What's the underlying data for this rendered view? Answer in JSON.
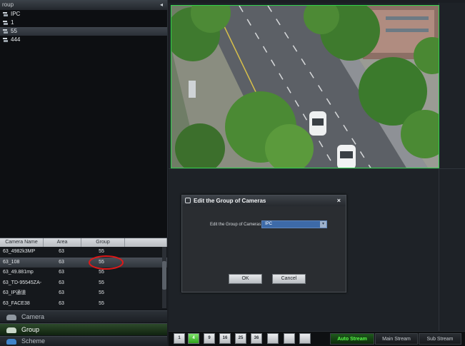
{
  "group_panel": {
    "header": "roup",
    "collapse_glyph": "◂",
    "items": [
      {
        "label": "IPC"
      },
      {
        "label": "1"
      },
      {
        "label": "55"
      },
      {
        "label": "444"
      }
    ]
  },
  "camera_table": {
    "columns": [
      "Camera Name",
      "Area",
      "Group"
    ],
    "rows": [
      {
        "name": "63_4982k3MP",
        "area": "63",
        "group": "55"
      },
      {
        "name": "63_108",
        "area": "63",
        "group": "55"
      },
      {
        "name": "63_49.881mp",
        "area": "63",
        "group": "55"
      },
      {
        "name": "63_TD-95545ZA-",
        "area": "63",
        "group": "55"
      },
      {
        "name": "63_IP通道",
        "area": "63",
        "group": "55"
      },
      {
        "name": "63_FACE38",
        "area": "63",
        "group": "55"
      }
    ]
  },
  "nav": {
    "camera": "Camera",
    "group": "Group",
    "scheme": "Scheme"
  },
  "dialog": {
    "title": "Edit the Group of Cameras",
    "close": "×",
    "field_label": "Edit the Group of Cameras",
    "selected_value": "IPC",
    "arrow": "▾",
    "ok": "OK",
    "cancel": "Cancel"
  },
  "toolbar": {
    "layout_buttons": [
      "1",
      "4",
      "9",
      "16",
      "25",
      "36",
      "",
      "",
      ""
    ],
    "streams": [
      "Auto Stream",
      "Main Stream",
      "Sub Stream"
    ]
  },
  "colors": {
    "selection_border": "#2fd14a",
    "highlight_circle": "#e01818",
    "active_stream": "#58ff48"
  }
}
